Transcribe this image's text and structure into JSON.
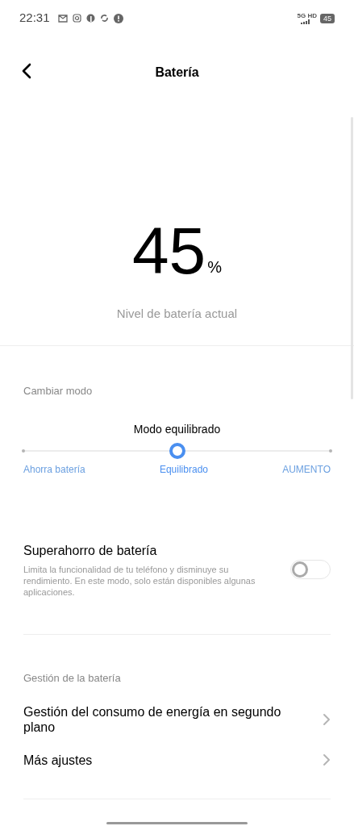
{
  "status_bar": {
    "time": "22:31",
    "network": "5G HD",
    "battery": "45"
  },
  "header": {
    "title": "Batería"
  },
  "battery": {
    "value": "45",
    "unit": "%",
    "caption": "Nivel de batería actual"
  },
  "mode": {
    "section": "Cambiar modo",
    "current": "Modo equilibrado",
    "options": [
      {
        "label": "Ahorra batería",
        "selected": false
      },
      {
        "label": "Equilibrado",
        "selected": true
      },
      {
        "label": "AUMENTO",
        "selected": false
      }
    ]
  },
  "super_saver": {
    "title": "Superahorro de batería",
    "description": "Limita la funcionalidad de tu teléfono y disminuye su rendimiento. En este modo, solo están disponibles algunas aplicaciones.",
    "on": false
  },
  "management": {
    "section": "Gestión de la batería",
    "items": [
      {
        "label": "Gestión del consumo de energía en segundo plano"
      },
      {
        "label": "Más ajustes"
      }
    ]
  }
}
